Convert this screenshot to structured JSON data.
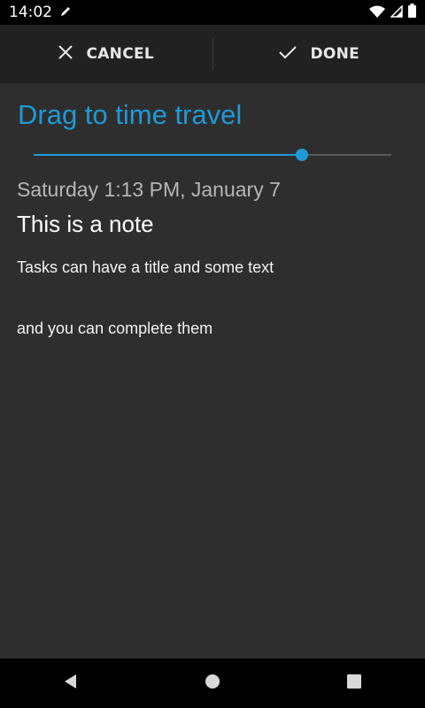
{
  "status_bar": {
    "time": "14:02",
    "icons": [
      "pencil-icon",
      "wifi-icon",
      "signal-icon",
      "battery-icon"
    ]
  },
  "action_bar": {
    "cancel_label": "CANCEL",
    "done_label": "DONE"
  },
  "time_travel": {
    "title": "Drag to time travel",
    "slider_value_fraction": 0.75
  },
  "note": {
    "date": "Saturday 1:13 PM, January 7",
    "title": "This is a note",
    "body_lines": [
      "Tasks can have a title and some text",
      "",
      "and you can complete them"
    ]
  },
  "nav_bar": {
    "icons": [
      "back-icon",
      "home-icon",
      "recents-icon"
    ]
  },
  "colors": {
    "accent": "#1e9ad6",
    "background": "#2e2e2e",
    "action_bar": "#212121"
  }
}
